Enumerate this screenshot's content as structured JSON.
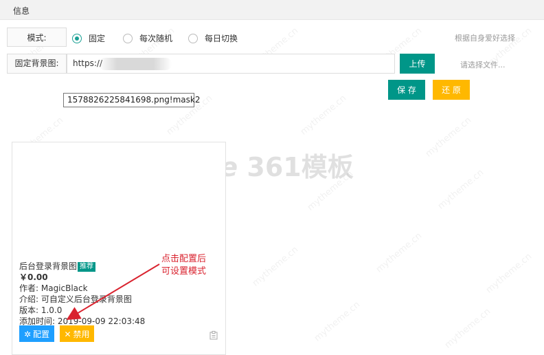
{
  "header": {
    "title": "信息"
  },
  "mode": {
    "label": "模式:",
    "options": [
      {
        "label": "固定",
        "checked": true
      },
      {
        "label": "每次随机",
        "checked": false
      },
      {
        "label": "每日切换",
        "checked": false
      }
    ],
    "hint": "根据自身爱好选择"
  },
  "fixed_bg": {
    "label": "固定背景图:",
    "url_value": "https://",
    "upload_label": "上传",
    "file_hint": "请选择文件...",
    "filename": "1578826225841698.png!mask2"
  },
  "actions": {
    "save_label": "保 存",
    "restore_label": "还 原"
  },
  "plugin": {
    "name": "后台登录背景图",
    "badge": "推荐",
    "price": "￥0.00",
    "author": "作者: MagicBlack",
    "intro": "介绍: 可自定义后台登录背景图",
    "version": "版本: 1.0.0",
    "added": "添加时间: 2019-09-09 22:03:48",
    "config_label": "配置",
    "disable_label": "禁用"
  },
  "annotation": {
    "line1": "点击配置后",
    "line2": "可设置模式"
  },
  "watermark": {
    "brand": "361模板",
    "site": "mytheme.cn"
  },
  "colors": {
    "primary": "#009688",
    "warning": "#ffb800",
    "blue": "#1e9fff",
    "annotation": "#d9232f"
  },
  "icons": {
    "config": "gear-icon",
    "disable": "close-icon",
    "clipboard": "clipboard-icon"
  }
}
